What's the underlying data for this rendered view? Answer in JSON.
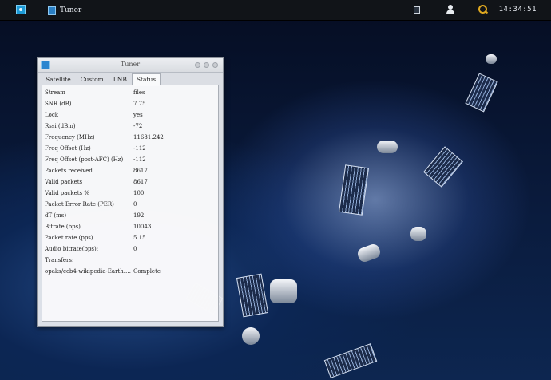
{
  "taskbar": {
    "app_label": "Tuner",
    "clock": "14:34:51"
  },
  "window": {
    "title": "Tuner",
    "tabs": [
      "Satellite",
      "Custom",
      "LNB",
      "Status"
    ],
    "active_tab": "Status"
  },
  "status": {
    "rows": [
      {
        "key": "Stream",
        "value": "files"
      },
      {
        "key": "SNR (dB)",
        "value": "7.75"
      },
      {
        "key": "Lock",
        "value": "yes"
      },
      {
        "key": "Rssi (dBm)",
        "value": "-72"
      },
      {
        "key": "Frequency (MHz)",
        "value": "11681.242"
      },
      {
        "key": "Freq Offset (Hz)",
        "value": "-112"
      },
      {
        "key": "Freq Offset (post-AFC) (Hz)",
        "value": "-112"
      },
      {
        "key": "Packets received",
        "value": "8617"
      },
      {
        "key": "Valid packets",
        "value": "8617"
      },
      {
        "key": "Valid packets %",
        "value": "100"
      },
      {
        "key": "Packet Error Rate (PER)",
        "value": "0"
      },
      {
        "key": "dT (ms)",
        "value": "192"
      },
      {
        "key": "Bitrate (bps)",
        "value": "10043"
      },
      {
        "key": "Packet rate (pps)",
        "value": "5.15"
      },
      {
        "key": "Audio bitrate(bps):",
        "value": "0"
      },
      {
        "key": "Transfers:",
        "value": ""
      },
      {
        "key": "opaks/ccb4-wikipedia-Earth.html.t...",
        "value": "Complete"
      }
    ]
  },
  "colors": {
    "accent": "#1d9ad6",
    "taskbar_bg": "#111418",
    "clock_icon": "#e0a920"
  }
}
